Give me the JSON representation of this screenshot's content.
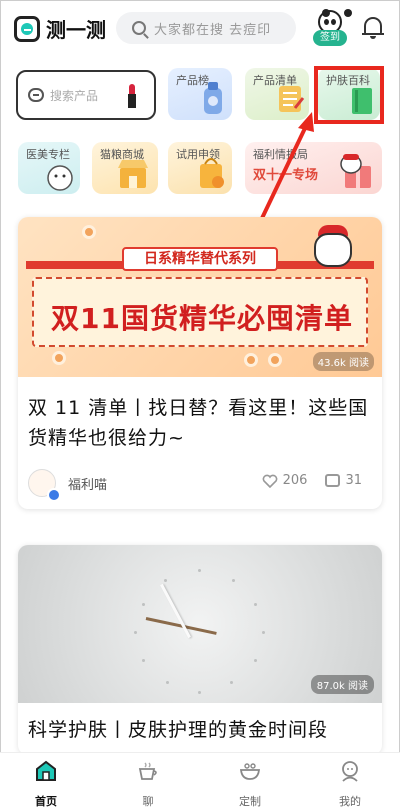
{
  "header": {
    "app_name": "测一测",
    "search_placeholder": "大家都在搜 去痘印",
    "checkin_label": "签到"
  },
  "shortcuts": {
    "search_box_placeholder": "搜索产品",
    "tiles": [
      {
        "label": "产品榜"
      },
      {
        "label": "产品清单"
      },
      {
        "label": "护肤百科"
      },
      {
        "label": "医美专栏"
      },
      {
        "label": "猫粮商城"
      },
      {
        "label": "试用申领"
      },
      {
        "label": "福利情报局",
        "sub": "双十一专场"
      }
    ]
  },
  "feed": [
    {
      "banner_tag": "日系精华替代系列",
      "banner_title": "双11国货精华必囤清单",
      "views": "43.6k 阅读",
      "title": "双 11 清单丨找日替？看这里！这些国货精华也很给力~",
      "author": "福利喵",
      "likes": "206",
      "comments": "31"
    },
    {
      "views": "87.0k 阅读",
      "title": "科学护肤丨皮肤护理的黄金时间段"
    }
  ],
  "tabbar": [
    {
      "label": "首页",
      "icon": "home-icon"
    },
    {
      "label": "聊",
      "icon": "chat-cup-icon"
    },
    {
      "label": "定制",
      "icon": "bowl-icon"
    },
    {
      "label": "我的",
      "icon": "profile-icon"
    }
  ],
  "colors": {
    "accent": "#e8281e",
    "brand_teal": "#1ec8b7",
    "checkin_green": "#25b38f"
  }
}
